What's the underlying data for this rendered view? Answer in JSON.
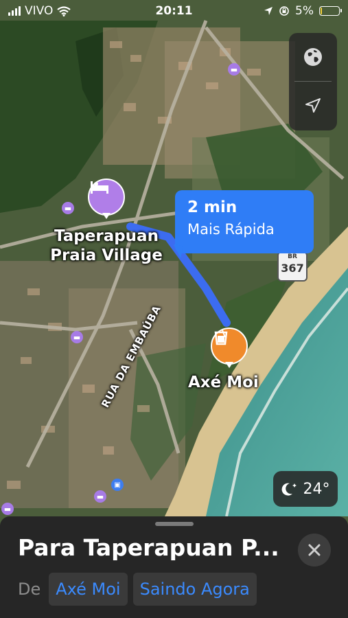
{
  "status_bar": {
    "carrier": "VIVO",
    "time": "20:11",
    "battery": "5%",
    "battery_level": 0.05
  },
  "map": {
    "street_label": "RUA DA EMBAÚBA",
    "highway_shield": {
      "top": "BR",
      "number": "367"
    },
    "places": [
      {
        "name_line1": "Taperapuan",
        "name_line2": "Praia Village",
        "icon": "bed-icon",
        "color": "#b07ee8"
      },
      {
        "name": "Axé Moi",
        "icon": "cocktail-icon",
        "color": "#f08a2b"
      }
    ],
    "route_color": "#3c6cf0"
  },
  "route_callout": {
    "eta": "2 min",
    "label": "Mais Rápida"
  },
  "map_controls": {
    "globe_icon": "globe-icon",
    "location_icon": "location-arrow-icon"
  },
  "weather": {
    "icon": "moon-stars-icon",
    "temperature": "24°"
  },
  "sheet": {
    "destination": "Para Taperapuan P...",
    "from_label": "De",
    "from_value": "Axé Moi",
    "departure": "Saindo Agora"
  }
}
